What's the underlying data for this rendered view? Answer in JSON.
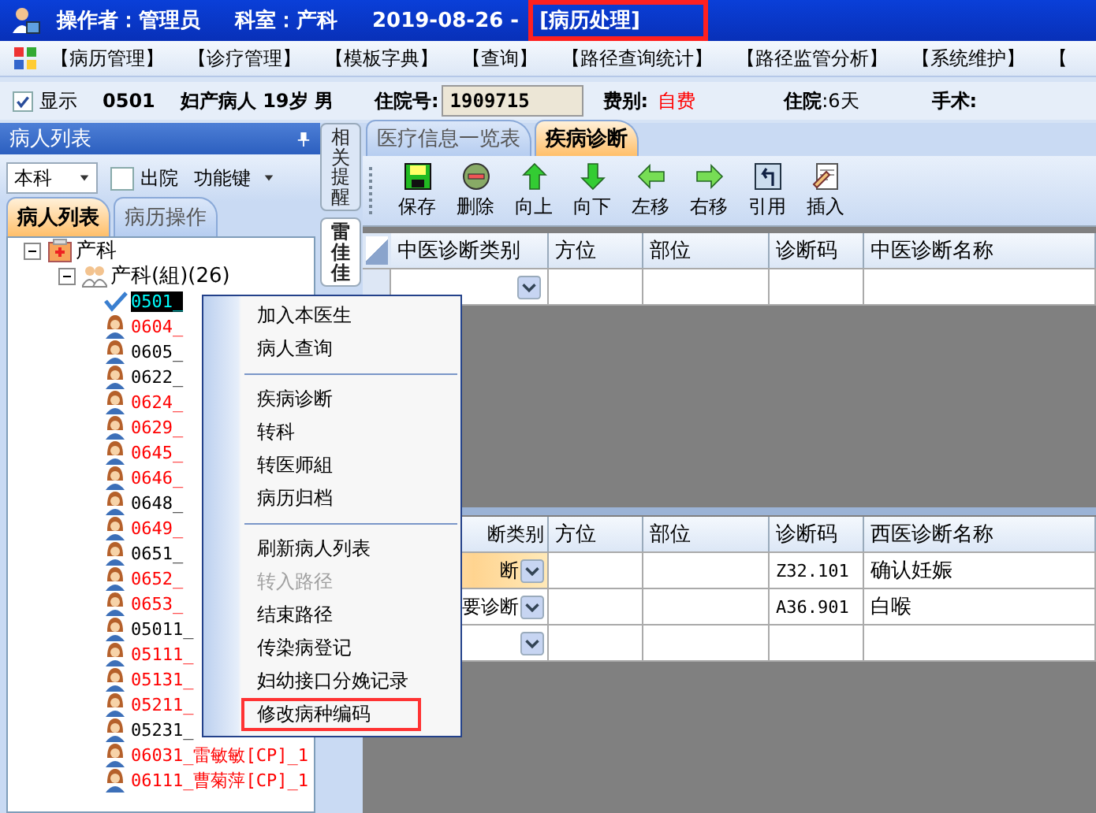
{
  "title_bar": {
    "operator": "操作者：管理员",
    "department": "科室：产科",
    "date": "2019-08-26 -",
    "module": "[病历处理]",
    "module_marked": true
  },
  "menu_bar": [
    "【病历管理】",
    "【诊疗管理】",
    "【模板字典】",
    "【查询】",
    "【路径查询统计】",
    "【路径监管分析】",
    "【系统维护】",
    "【"
  ],
  "patient_bar": {
    "show": {
      "label": "显示",
      "checked": true
    },
    "bed": "0501",
    "patient": "妇产病人 19岁 男",
    "admission_label": "住院号:",
    "admission_no": "1909715",
    "fee_label": "费别:",
    "fee": "自费",
    "stay": "**住院**:6天",
    "surgery": "手术:"
  },
  "left_panel": {
    "title": "病人列表",
    "scope": "本科",
    "discharged": {
      "label": "出院",
      "checked": false
    },
    "function_keys": "功能键",
    "tabs": [
      {
        "label": "病人列表",
        "selected": true
      },
      {
        "label": "病历操作",
        "selected": false
      }
    ],
    "tree": [
      {
        "label": "产科",
        "kind": "department",
        "expanded": true,
        "children": [
          {
            "label": "产科(組)(26)",
            "kind": "group",
            "expanded": true,
            "children": [
              {
                "label": "0501_",
                "kind": "patient",
                "selected": true
              },
              {
                "label": "0604_",
                "kind": "patient",
                "selected": false,
                "color": "#ff0000"
              },
              {
                "label": "0605_",
                "kind": "patient",
                "selected": false,
                "color": "#000000"
              },
              {
                "label": "0622_",
                "kind": "patient",
                "selected": false,
                "color": "#000000"
              },
              {
                "label": "0624_",
                "kind": "patient",
                "selected": false,
                "color": "#ff0000"
              },
              {
                "label": "0629_",
                "kind": "patient",
                "selected": false,
                "color": "#ff0000"
              },
              {
                "label": "0645_",
                "kind": "patient",
                "selected": false,
                "color": "#ff0000"
              },
              {
                "label": "0646_",
                "kind": "patient",
                "selected": false,
                "color": "#ff0000"
              },
              {
                "label": "0648_",
                "kind": "patient",
                "selected": false,
                "color": "#000000"
              },
              {
                "label": "0649_",
                "kind": "patient",
                "selected": false,
                "color": "#ff0000"
              },
              {
                "label": "0651_",
                "kind": "patient",
                "selected": false,
                "color": "#000000"
              },
              {
                "label": "0652_",
                "kind": "patient",
                "selected": false,
                "color": "#ff0000"
              },
              {
                "label": "0653_",
                "kind": "patient",
                "selected": false,
                "color": "#ff0000"
              },
              {
                "label": "05011_",
                "kind": "patient",
                "selected": false,
                "color": "#000000"
              },
              {
                "label": "05111_",
                "kind": "patient",
                "selected": false,
                "color": "#ff0000"
              },
              {
                "label": "05131_",
                "kind": "patient",
                "selected": false,
                "color": "#ff0000"
              },
              {
                "label": "05211_",
                "kind": "patient",
                "selected": false,
                "color": "#ff0000"
              },
              {
                "label": "05231_",
                "kind": "patient",
                "selected": false,
                "color": "#000000"
              },
              {
                "label": "06031_雷敏敏[CP]_1",
                "kind": "patient",
                "selected": false,
                "color": "#ff0000"
              },
              {
                "label": "06111_曹菊萍[CP]_1",
                "kind": "patient",
                "selected": false,
                "color": "#ff0000"
              }
            ]
          }
        ]
      }
    ]
  },
  "side_tabs": [
    {
      "label": "相关提醒",
      "selected": false
    },
    {
      "label": "雷佳佳",
      "selected": true
    }
  ],
  "main_tabs": [
    {
      "label": "医疗信息一览表",
      "selected": false
    },
    {
      "label": "疾病诊断",
      "selected": true
    }
  ],
  "toolbar": [
    {
      "label": "保存",
      "kind": "save"
    },
    {
      "label": "删除",
      "kind": "delete"
    },
    {
      "label": "向上",
      "kind": "up"
    },
    {
      "label": "向下",
      "kind": "down"
    },
    {
      "label": "左移",
      "kind": "left"
    },
    {
      "label": "右移",
      "kind": "right"
    },
    {
      "label": "引用",
      "kind": "quote"
    },
    {
      "label": "插入",
      "kind": "insert"
    }
  ],
  "tcm_grid": {
    "columns": [
      "中医诊断类别",
      "方位",
      "部位",
      "诊断码",
      "中医诊断名称"
    ],
    "rows": [
      {
        "selected": false
      }
    ]
  },
  "western_grid": {
    "columns": [
      "断类别",
      "方位",
      "部位",
      "诊断码",
      "西医诊断名称"
    ],
    "rows": [
      {
        "category": "断",
        "code": "Z32.101",
        "name": "确认妊娠",
        "selected": true
      },
      {
        "category": "要诊断",
        "code": "A36.901",
        "name": "白喉",
        "selected": false
      },
      {
        "selected": false
      }
    ]
  },
  "context_menu": [
    {
      "kind": "item",
      "label": "加入本医生",
      "disabled": false,
      "marked": false
    },
    {
      "kind": "item",
      "label": "病人查询",
      "disabled": false,
      "marked": false
    },
    {
      "kind": "separator"
    },
    {
      "kind": "item",
      "label": "疾病诊断",
      "disabled": false,
      "marked": false
    },
    {
      "kind": "item",
      "label": "转科",
      "disabled": false,
      "marked": false
    },
    {
      "kind": "item",
      "label": "转医师組",
      "disabled": false,
      "marked": false
    },
    {
      "kind": "item",
      "label": "病历归档",
      "disabled": false,
      "marked": false
    },
    {
      "kind": "separator"
    },
    {
      "kind": "item",
      "label": "刷新病人列表",
      "disabled": false,
      "marked": false
    },
    {
      "kind": "item",
      "label": "转入路径",
      "disabled": true,
      "marked": false
    },
    {
      "kind": "item",
      "label": "结束路径",
      "disabled": false,
      "marked": false
    },
    {
      "kind": "item",
      "label": "传染病登记",
      "disabled": false,
      "marked": false
    },
    {
      "kind": "item",
      "label": "妇幼接口分娩记录",
      "disabled": false,
      "marked": false
    },
    {
      "kind": "item",
      "label": "修改病种编码",
      "disabled": false,
      "marked": true
    }
  ]
}
